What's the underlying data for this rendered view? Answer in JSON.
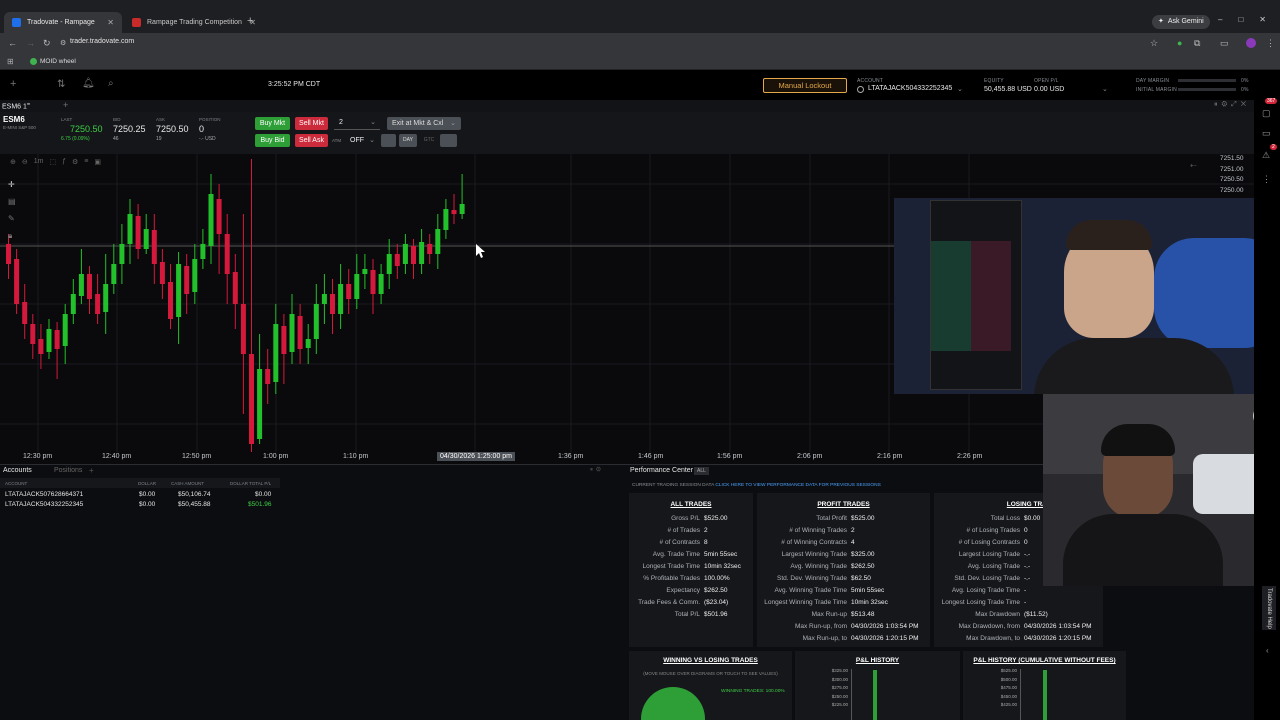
{
  "browser": {
    "tabs": [
      {
        "label": "Tradovate - Rampage",
        "active": true
      },
      {
        "label": "Rampage Trading Competition",
        "active": false
      }
    ],
    "gemini_label": "Ask Gemini",
    "url": "trader.tradovate.com",
    "bookmark": "MOID wheel"
  },
  "header": {
    "clock": "3:25:52 PM CDT",
    "lockout_label": "Manual Lockout",
    "account_label": "ACCOUNT",
    "account_value": "LTATAJACK504332252345",
    "equity_label": "EQUITY",
    "equity_value": "50,455.88 USD",
    "open_pl_label": "OPEN P/L",
    "open_pl_value": "0.00 USD",
    "day_margin_label": "DAY MARGIN",
    "day_margin_pct": "0%",
    "initial_margin_label": "INITIAL MARGIN",
    "initial_margin_pct": "0%"
  },
  "module": {
    "tab_label": "ESM6 1",
    "tab_sup": "m",
    "symbol": "ESM6",
    "symbol_desc": "E-MINI S&P 500",
    "last_label": "LAST",
    "last_value": "7250.50",
    "last_change": "6.75 (0.09%)",
    "bid_label": "BID",
    "bid_value": "7250.25",
    "bid_size": "46",
    "ask_label": "ASK",
    "ask_value": "7250.50",
    "ask_size": "19",
    "position_label": "POSITION",
    "position_value": "0",
    "position_sub": "-.- USD",
    "buy_mkt": "Buy Mkt",
    "sell_mkt": "Sell Mkt",
    "qty": "2",
    "exit_label": "Exit at Mkt & Cxl",
    "buy_bid": "Buy Bid",
    "sell_ask": "Sell Ask",
    "atm_label": "ATM",
    "atm_value": "OFF",
    "day_label": "DAY",
    "gtc_label": "GTC",
    "interval": "1m"
  },
  "chart_data": {
    "type": "candlestick",
    "price_ticks": [
      "7251.50",
      "7251.00",
      "7250.50",
      "7250.00"
    ],
    "time_ticks": [
      "12:30 pm",
      "12:40 pm",
      "12:50 pm",
      "1:00 pm",
      "1:10 pm",
      "04/30/2026 1:25:00 pm",
      "1:36 pm",
      "1:46 pm",
      "1:56 pm",
      "2:06 pm",
      "2:16 pm",
      "2:26 pm"
    ],
    "grid": true,
    "up_color": "#22c02a",
    "down_color": "#d4193c"
  },
  "accounts": {
    "tab_accounts": "Accounts",
    "tab_positions": "Positions",
    "col_account": "ACCOUNT",
    "col_dollar": "DOLLAR",
    "col_cash": "CASH AMOUNT",
    "col_total": "DOLLAR TOTAL P/L",
    "rows": [
      {
        "account": "LTATAJACK507628664371",
        "dollar": "$0.00",
        "cash": "$50,106.74",
        "total": "$0.00"
      },
      {
        "account": "LTATAJACK504332252345",
        "dollar": "$0.00",
        "cash": "$50,455.88",
        "total": "$501.96"
      }
    ]
  },
  "perf": {
    "title": "Performance Center",
    "all_badge": "ALL",
    "session_note": "CURRENT TRADING SESSION DATA",
    "session_link": "CLICK HERE TO VIEW PERFORMANCE DATA FOR PREVIOUS SESSIONS",
    "all_trades": {
      "title": "ALL TRADES",
      "rows": [
        [
          "Gross P/L",
          "$525.00"
        ],
        [
          "# of Trades",
          "2"
        ],
        [
          "# of Contracts",
          "8"
        ],
        [
          "Avg. Trade Time",
          "5min 55sec"
        ],
        [
          "Longest Trade Time",
          "10min 32sec"
        ],
        [
          "% Profitable Trades",
          "100.00%"
        ],
        [
          "Expectancy",
          "$262.50"
        ],
        [
          "Trade Fees & Comm.",
          "($23.04)"
        ],
        [
          "Total P/L",
          "$501.96"
        ]
      ]
    },
    "profit_trades": {
      "title": "PROFIT TRADES",
      "rows": [
        [
          "Total Profit",
          "$525.00"
        ],
        [
          "# of Winning Trades",
          "2"
        ],
        [
          "# of Winning Contracts",
          "4"
        ],
        [
          "Largest Winning Trade",
          "$325.00"
        ],
        [
          "Avg. Winning Trade",
          "$262.50"
        ],
        [
          "Std. Dev. Winning Trade",
          "$62.50"
        ],
        [
          "Avg. Winning Trade Time",
          "5min 55sec"
        ],
        [
          "Longest Winning Trade Time",
          "10min 32sec"
        ],
        [
          "Max Run-up",
          "$513.48"
        ],
        [
          "Max Run-up, from",
          "04/30/2026 1:03:54 PM"
        ],
        [
          "Max Run-up, to",
          "04/30/2026 1:20:15 PM"
        ]
      ]
    },
    "losing_trades": {
      "title": "LOSING TRADES",
      "rows": [
        [
          "Total Loss",
          "$0.00"
        ],
        [
          "# of Losing Trades",
          "0"
        ],
        [
          "# of Losing Contracts",
          "0"
        ],
        [
          "Largest Losing Trade",
          "-.-"
        ],
        [
          "Avg. Losing Trade",
          "-.-"
        ],
        [
          "Std. Dev. Losing Trade",
          "-.-"
        ],
        [
          "Avg. Losing Trade Time",
          "-"
        ],
        [
          "Longest Losing Trade Time",
          "-"
        ],
        [
          "Max Drawdown",
          "($11.52)"
        ],
        [
          "Max Drawdown, from",
          "04/30/2026 1:03:54 PM"
        ],
        [
          "Max Drawdown, to",
          "04/30/2026 1:20:15 PM"
        ]
      ]
    },
    "winning_vs_losing": {
      "title": "WINNING VS LOSING TRADES",
      "hint": "(MOVE MOUSE OVER DIAGRAMS OR TOUCH TO SEE VALUES)",
      "legend": "WINNING TRADES: 100.00%",
      "win_fraction": 1.0
    },
    "pl_history": {
      "title": "P&L HISTORY",
      "ticks": [
        "$325.00",
        "$300.00",
        "$275.00",
        "$250.00",
        "$225.00"
      ]
    },
    "pl_history_cum": {
      "title": "P&L HISTORY (CUMULATIVE WITHOUT FEES)",
      "ticks": [
        "$525.00",
        "$500.00",
        "$475.00",
        "$450.00",
        "$425.00"
      ]
    }
  },
  "sidebar": {
    "badge_top": "367",
    "badge_mid": "2",
    "help_label": "Tradovate Help"
  },
  "colors": {
    "buy": "#2e9e37",
    "sell": "#cc2b3b",
    "accent_lock": "#e4a74a",
    "link": "#4aa3ff"
  }
}
